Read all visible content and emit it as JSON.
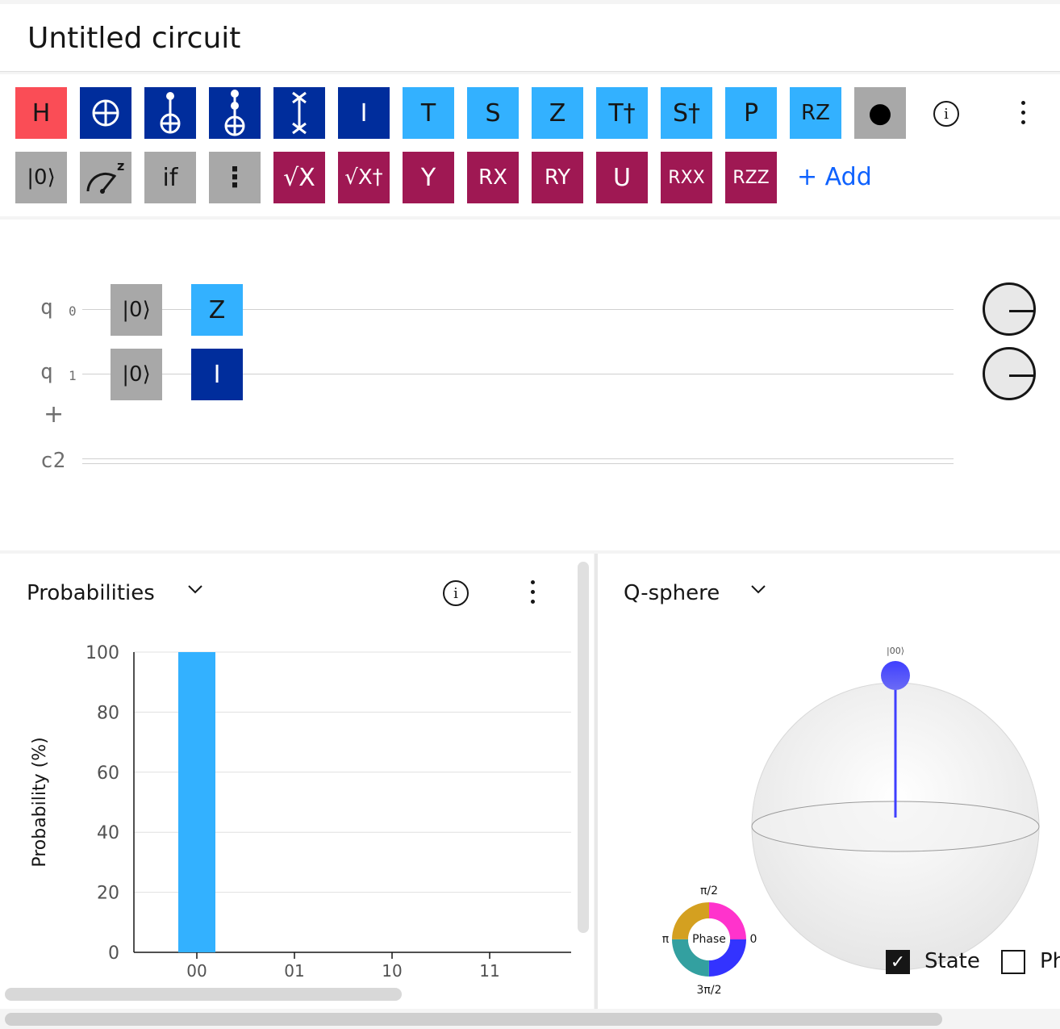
{
  "title": "Untitled circuit",
  "palette": {
    "row1": [
      {
        "label": "H",
        "name": "gate-h"
      },
      {
        "label": "",
        "name": "gate-not"
      },
      {
        "label": "",
        "name": "gate-cnot"
      },
      {
        "label": "",
        "name": "gate-toffoli"
      },
      {
        "label": "",
        "name": "gate-swap"
      },
      {
        "label": "I",
        "name": "gate-i"
      },
      {
        "label": "T",
        "name": "gate-t"
      },
      {
        "label": "S",
        "name": "gate-s"
      },
      {
        "label": "Z",
        "name": "gate-z"
      },
      {
        "label": "T†",
        "name": "gate-tdg"
      },
      {
        "label": "S†",
        "name": "gate-sdg"
      },
      {
        "label": "P",
        "name": "gate-p"
      },
      {
        "label": "RZ",
        "name": "gate-rz"
      },
      {
        "label": "●",
        "name": "gate-control"
      }
    ],
    "row2": [
      {
        "label": "|0⟩",
        "name": "gate-reset"
      },
      {
        "label": "",
        "name": "gate-measure"
      },
      {
        "label": "if",
        "name": "gate-if"
      },
      {
        "label": "⋮",
        "name": "gate-barrier"
      },
      {
        "label": "√X",
        "name": "gate-sx"
      },
      {
        "label": "√X†",
        "name": "gate-sxdg"
      },
      {
        "label": "Y",
        "name": "gate-y"
      },
      {
        "label": "RX",
        "name": "gate-rx"
      },
      {
        "label": "RY",
        "name": "gate-ry"
      },
      {
        "label": "U",
        "name": "gate-u"
      },
      {
        "label": "RXX",
        "name": "gate-rxx"
      },
      {
        "label": "RZZ",
        "name": "gate-rzz"
      }
    ],
    "add_label": "+ Add"
  },
  "circuit": {
    "qubits": [
      {
        "label": "q",
        "index": "0",
        "init": "|0⟩",
        "gate": "Z"
      },
      {
        "label": "q",
        "index": "1",
        "init": "|0⟩",
        "gate": "I"
      }
    ],
    "add_qubit": "+",
    "classical": "c2"
  },
  "probabilities": {
    "title": "Probabilities",
    "ylabel": "Probability (%)"
  },
  "chart_data": {
    "type": "bar",
    "categories": [
      "00",
      "01",
      "10",
      "11"
    ],
    "values": [
      100,
      0,
      0,
      0
    ],
    "ylim": [
      0,
      100
    ],
    "yticks": [
      0,
      20,
      40,
      60,
      80,
      100
    ],
    "xlabel": "",
    "ylabel": "Probability (%)",
    "bar_color": "#33b1ff",
    "grid": true
  },
  "qsphere": {
    "title": "Q-sphere",
    "state_label": "|00⟩",
    "phase": {
      "center": "Phase",
      "top": "π/2",
      "left": "π",
      "right": "0",
      "bottom": "3π/2"
    },
    "state_checkbox": "State",
    "phase_checkbox": "Ph"
  },
  "colors": {
    "navy": "#002d9c",
    "sky": "#33b1ff",
    "wine": "#9f1853",
    "red": "#fa4d56",
    "gray": "#a8a8a8",
    "link": "#0f62fe"
  }
}
